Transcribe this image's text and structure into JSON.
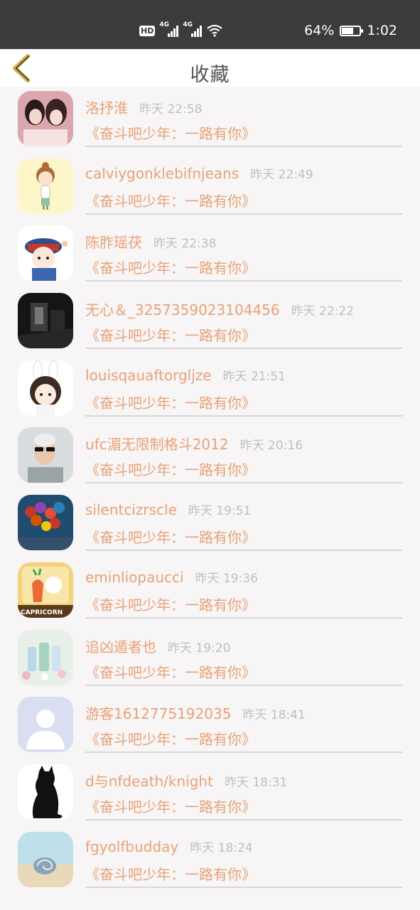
{
  "status_bar": {
    "hd": "HD",
    "net1": "4G",
    "net2": "4G",
    "battery": "64%",
    "battery_level": 0.64,
    "time": "1:02",
    "icons": [
      "hd-icon",
      "signal-icon",
      "signal-icon",
      "wifi-icon",
      "battery-icon"
    ]
  },
  "nav": {
    "back_icon": "back-chevron-icon",
    "title": "收藏"
  },
  "colors": {
    "accent": "#e8a277",
    "muted": "#c0c0c0",
    "statusbar": "#3b3b3b",
    "back_icon": "#d9b23a"
  },
  "items": [
    {
      "name": "洛抒淮",
      "time": "昨天 22:58",
      "show": "《奋斗吧少年：一路有你》",
      "avatar": "photo-two-girls"
    },
    {
      "name": "calviygonklebifnjeans",
      "time": "昨天 22:49",
      "show": "《奋斗吧少年：一路有你》",
      "avatar": "cartoon-girl"
    },
    {
      "name": "陈胙瑶茯",
      "time": "昨天 22:38",
      "show": "《奋斗吧少年：一路有你》",
      "avatar": "cartoon-official"
    },
    {
      "name": "无心＆_3257359023104456",
      "time": "昨天 22:22",
      "show": "《奋斗吧少年：一路有你》",
      "avatar": "dark-photo"
    },
    {
      "name": "louisqauaftorgljze",
      "time": "昨天 21:51",
      "show": "《奋斗吧少年：一路有你》",
      "avatar": "bunny-girl"
    },
    {
      "name": "ufc湄无限制格斗2012",
      "time": "昨天 20:16",
      "show": "《奋斗吧少年：一路有你》",
      "avatar": "man-sunglasses"
    },
    {
      "name": "silentcizrscle",
      "time": "昨天 19:51",
      "show": "《奋斗吧少年：一路有你》",
      "avatar": "balloons"
    },
    {
      "name": "eminliopaucci",
      "time": "昨天 19:36",
      "show": "《奋斗吧少年：一路有你》",
      "avatar": "capricorn-cartoon"
    },
    {
      "name": "追凶遁者也",
      "time": "昨天 19:20",
      "show": "《奋斗吧少年：一路有你》",
      "avatar": "bottles"
    },
    {
      "name": "游客1612775192035",
      "time": "昨天 18:41",
      "show": "《奋斗吧少年：一路有你》",
      "avatar": "default-user"
    },
    {
      "name": "d与nfdeath/knight",
      "time": "昨天 18:31",
      "show": "《奋斗吧少年：一路有你》",
      "avatar": "black-cat"
    },
    {
      "name": "fgyolfbudday",
      "time": "昨天 18:24",
      "show": "《奋斗吧少年：一路有你》",
      "avatar": "seashell"
    }
  ],
  "capricorn_text": "CAPRICORN"
}
